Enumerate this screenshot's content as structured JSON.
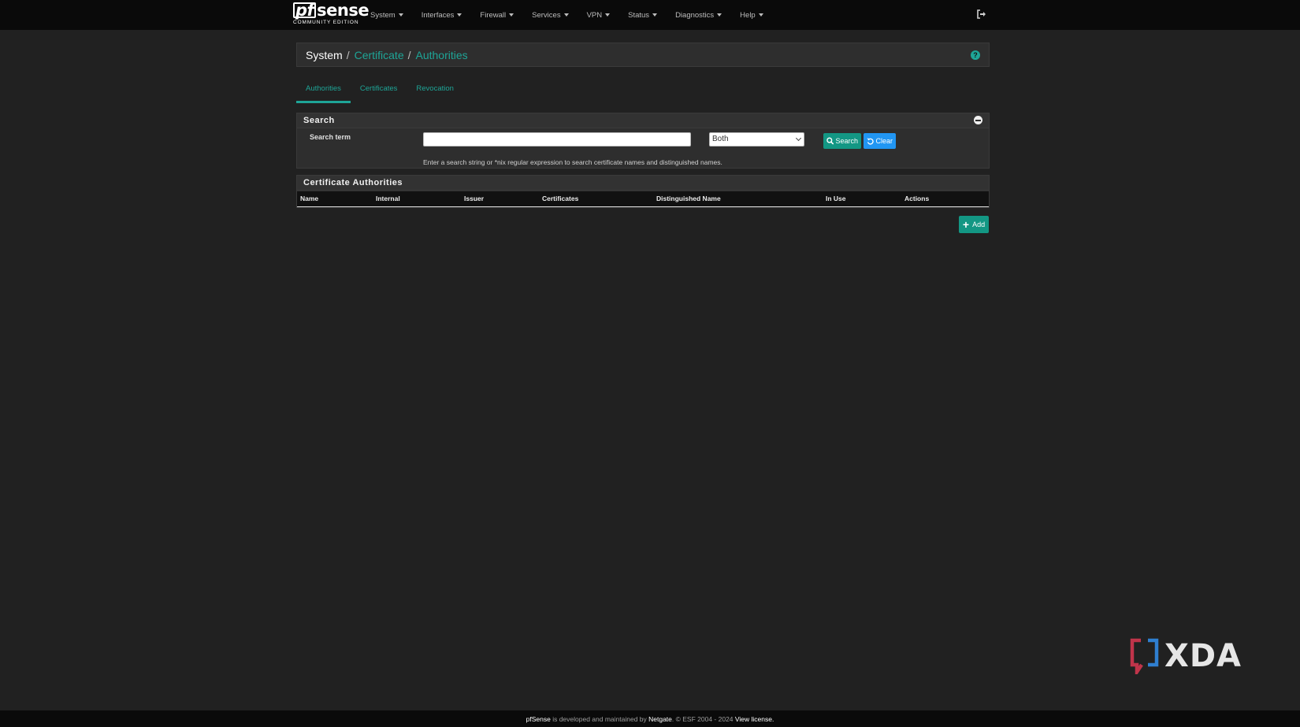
{
  "brand": {
    "logo": "sense",
    "logo_prefix": "pf",
    "subtitle": "COMMUNITY EDITION"
  },
  "nav": {
    "items": [
      {
        "label": "System"
      },
      {
        "label": "Interfaces"
      },
      {
        "label": "Firewall"
      },
      {
        "label": "Services"
      },
      {
        "label": "VPN"
      },
      {
        "label": "Status"
      },
      {
        "label": "Diagnostics"
      },
      {
        "label": "Help"
      }
    ],
    "logout_icon": "sign-out-icon"
  },
  "breadcrumb": {
    "root": "System",
    "sep": "/",
    "level1": "Certificate",
    "level2": "Authorities",
    "help_icon": "question-circle-icon"
  },
  "tabs": [
    {
      "label": "Authorities",
      "active": true
    },
    {
      "label": "Certificates",
      "active": false
    },
    {
      "label": "Revocation",
      "active": false
    }
  ],
  "search": {
    "heading": "Search",
    "term_label": "Search term",
    "input_value": "",
    "select_value": "Both",
    "search_button": "Search",
    "clear_button": "Clear",
    "hint": "Enter a search string or *nix regular expression to search certificate names and distinguished names."
  },
  "ca_table": {
    "heading": "Certificate Authorities",
    "columns": [
      "Name",
      "Internal",
      "Issuer",
      "Certificates",
      "Distinguished Name",
      "In Use",
      "Actions"
    ],
    "rows": []
  },
  "add_button": "Add",
  "watermark": "XDA",
  "footer": {
    "brand": "pfSense",
    "mid": " is developed and maintained by ",
    "company": "Netgate",
    "copyright": ". © ESF 2004 - 2024 ",
    "license": "View license."
  },
  "colors": {
    "accent": "#1ea597",
    "success": "#139784",
    "info": "#2196f3",
    "background": "#212121",
    "navbar": "#0a0a0a"
  }
}
